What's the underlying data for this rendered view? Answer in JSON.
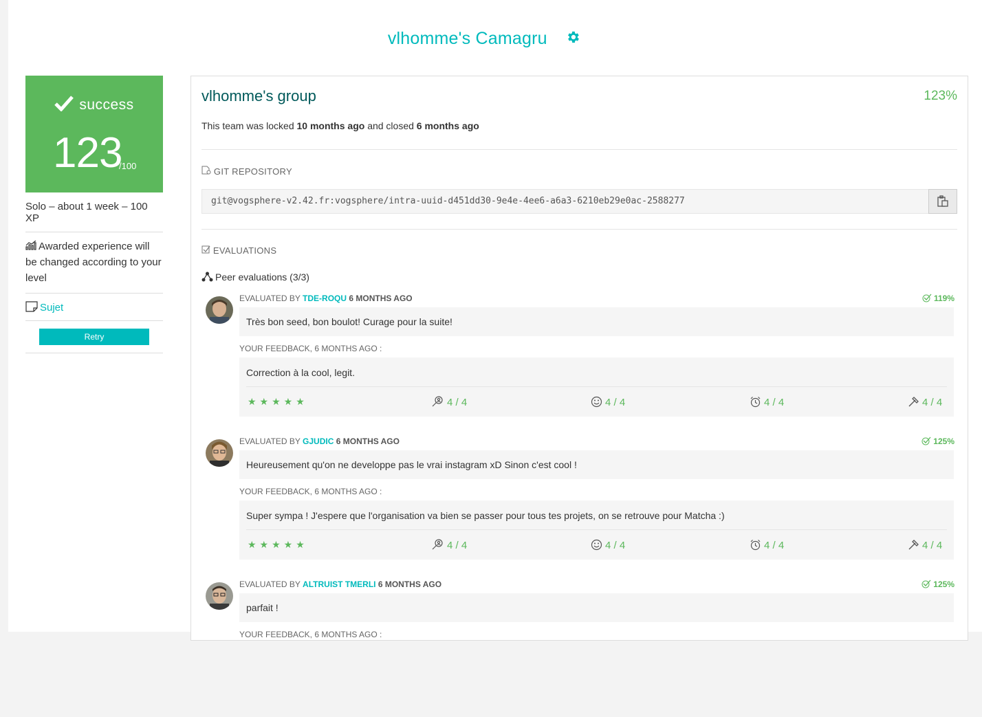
{
  "header": {
    "title": "vlhomme's Camagru"
  },
  "colors": {
    "accent": "#00babc",
    "success": "#5cb85c",
    "dark_teal": "#00595a"
  },
  "sidebar": {
    "status": "success",
    "score": "123",
    "score_max": "/100",
    "meta": "Solo – about 1 week – 100 XP",
    "xp_note": "Awarded experience will be changed according to your level",
    "sujet_label": "Sujet",
    "retry_label": "Retry"
  },
  "group": {
    "title": "vlhomme's group",
    "percent": "123%",
    "lock_prefix": "This team was locked",
    "locked_ago": "10 months ago",
    "lock_mid": "and closed",
    "closed_ago": "6 months ago"
  },
  "git": {
    "label": "GIT REPOSITORY",
    "url": "git@vogsphere-v2.42.fr:vogsphere/intra-uuid-d451dd30-9e4e-4ee6-a6a3-6210eb29e0ac-2588277"
  },
  "evaluations": {
    "label": "EVALUATIONS",
    "peer_label": "Peer evaluations (3/3)",
    "items": [
      {
        "evaluated_by": "EVALUATED BY",
        "login": "TDE-ROQU",
        "when": "6 MONTHS AGO",
        "percent": "119%",
        "comment": "Très bon seed, bon boulot! Curage pour la suite!",
        "feedback_head": "YOUR FEEDBACK, 6 MONTHS AGO :",
        "feedback": "Correction à la cool, legit.",
        "stars": "★★★★★",
        "ratings": [
          "4 / 4",
          "4 / 4",
          "4 / 4",
          "4 / 4"
        ]
      },
      {
        "evaluated_by": "EVALUATED BY",
        "login": "GJUDIC",
        "when": "6 MONTHS AGO",
        "percent": "125%",
        "comment": "Heureusement qu'on ne developpe pas le vrai instagram xD Sinon c'est cool !",
        "feedback_head": "YOUR FEEDBACK, 6 MONTHS AGO :",
        "feedback": "Super sympa ! J'espere que l'organisation va bien se passer pour tous tes projets, on se retrouve pour Matcha :)",
        "stars": "★★★★★",
        "ratings": [
          "4 / 4",
          "4 / 4",
          "4 / 4",
          "4 / 4"
        ]
      },
      {
        "evaluated_by": "EVALUATED BY",
        "login": "ALTRUIST TMERLI",
        "when": "6 MONTHS AGO",
        "percent": "125%",
        "comment": "parfait !",
        "feedback_head": "YOUR FEEDBACK, 6 MONTHS AGO :"
      }
    ]
  }
}
